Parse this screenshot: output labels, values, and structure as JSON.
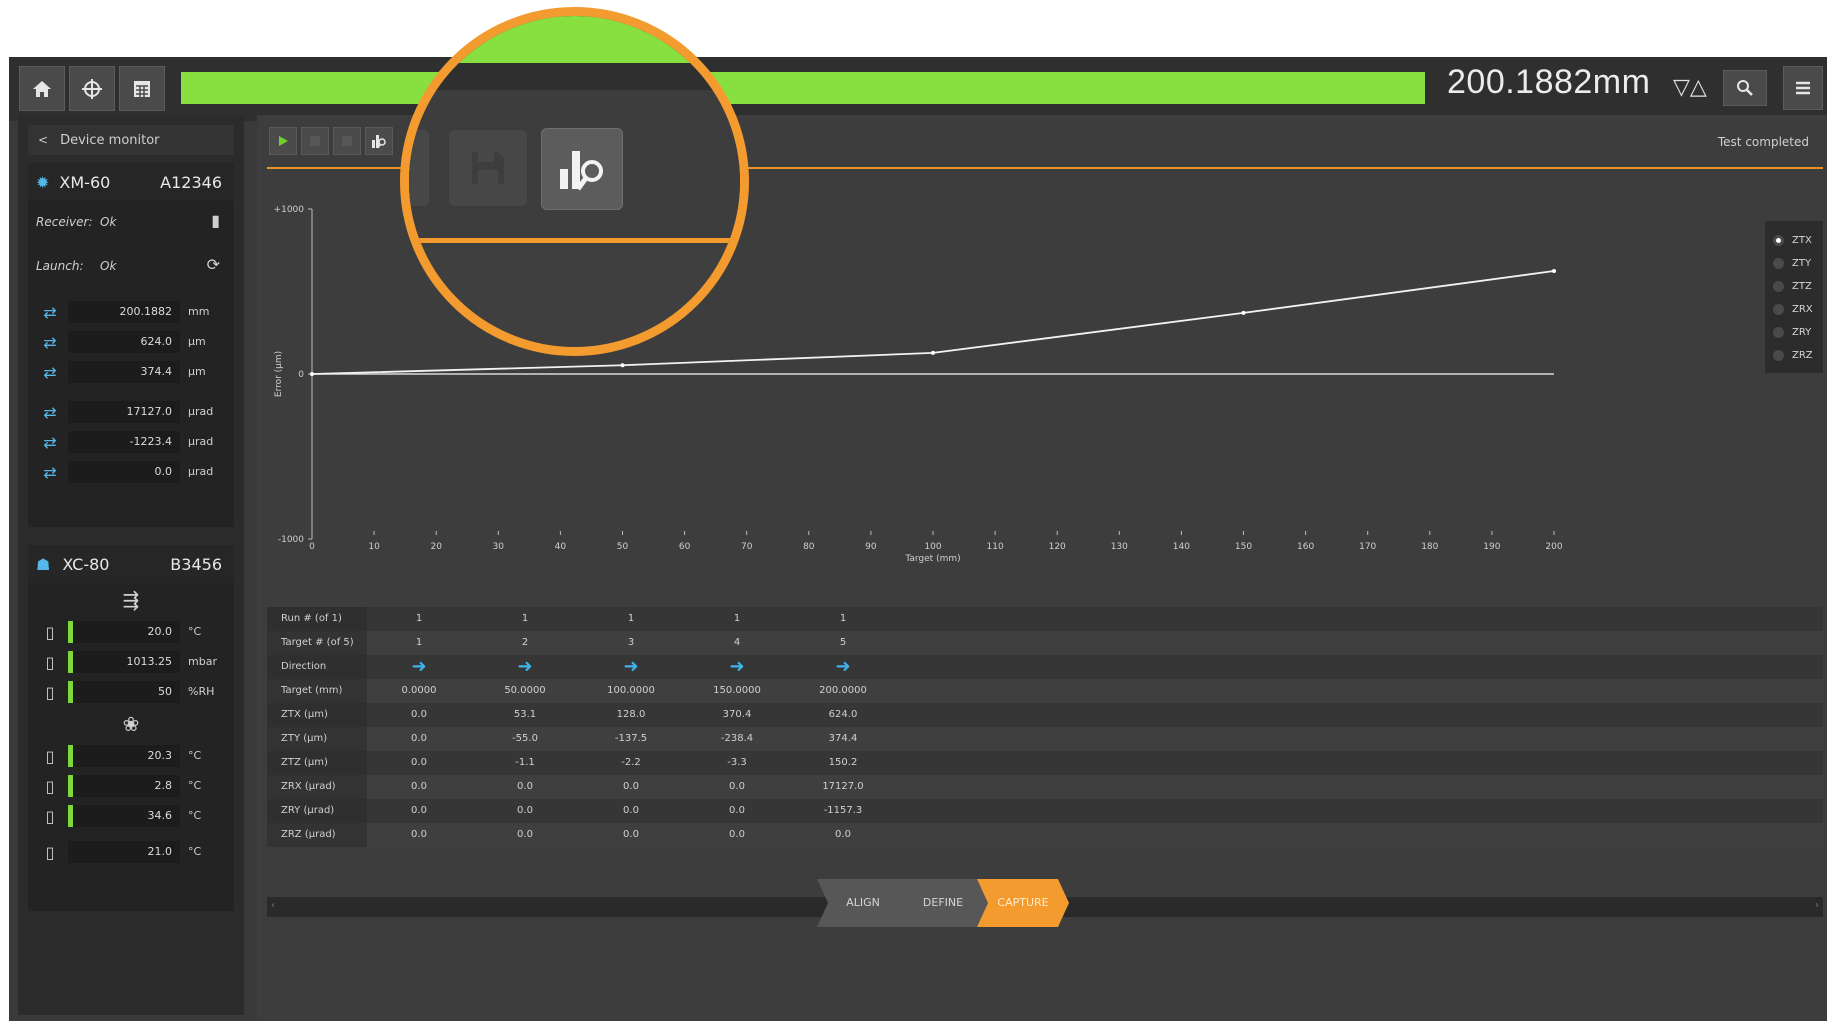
{
  "topbar": {
    "progress_fraction": 1.0,
    "progress_color": "#88e040",
    "readout": "200.1882mm",
    "direction_glyph": "▽△",
    "icons": [
      "home-icon",
      "target-icon",
      "calculator-icon",
      "search-icon",
      "menu-icon"
    ]
  },
  "device_monitor": {
    "title": "Device monitor",
    "xm": {
      "name": "XM-60",
      "serial": "A12346",
      "receiver_label": "Receiver:",
      "receiver_value": "Ok",
      "launch_label": "Launch:",
      "launch_value": "Ok",
      "values": [
        {
          "icon": "linear-icon",
          "value": "200.1882",
          "unit": "mm"
        },
        {
          "icon": "straightness-h-icon",
          "value": "624.0",
          "unit": "µm"
        },
        {
          "icon": "straightness-v-icon",
          "value": "374.4",
          "unit": "µm"
        },
        {
          "icon": "pitch-icon",
          "value": "17127.0",
          "unit": "µrad"
        },
        {
          "icon": "yaw-icon",
          "value": "-1223.4",
          "unit": "µrad"
        },
        {
          "icon": "roll-icon",
          "value": "0.0",
          "unit": "µrad"
        }
      ]
    },
    "xc": {
      "name": "XC-80",
      "serial": "B3456",
      "air": [
        {
          "icon": "thermometer-icon",
          "value": "20.0",
          "unit": "°C"
        },
        {
          "icon": "pressure-icon",
          "value": "1013.25",
          "unit": "mbar"
        },
        {
          "icon": "humidity-icon",
          "value": "50",
          "unit": "%RH"
        }
      ],
      "material": [
        {
          "icon": "material-sensor-icon",
          "value": "20.3",
          "unit": "°C"
        },
        {
          "icon": "material-sensor-icon",
          "value": "2.8",
          "unit": "°C"
        },
        {
          "icon": "material-sensor-icon",
          "value": "34.6",
          "unit": "°C"
        },
        {
          "icon": "material-sensor-icon",
          "value": "21.0",
          "unit": "°C"
        }
      ]
    }
  },
  "toolbar": {
    "status": "Test completed",
    "buttons": [
      "play-icon",
      "stop-icon",
      "save-icon",
      "analysis-icon"
    ]
  },
  "chart_data": {
    "type": "line",
    "xlabel": "Target (mm)",
    "ylabel": "Error (µm)",
    "xlim": [
      0,
      200
    ],
    "ylim": [
      -1000,
      1000
    ],
    "xticks": [
      0,
      10,
      20,
      30,
      40,
      50,
      60,
      70,
      80,
      90,
      100,
      110,
      120,
      130,
      140,
      150,
      160,
      170,
      180,
      190,
      200
    ],
    "yticks": [
      "1000",
      "0",
      "-1000"
    ],
    "series": [
      {
        "name": "ZTX",
        "x": [
          0,
          50,
          100,
          150,
          200
        ],
        "y": [
          0.0,
          53.1,
          128.0,
          370.4,
          624.0
        ]
      }
    ],
    "legend": [
      "ZTX",
      "ZTY",
      "ZTZ",
      "ZRX",
      "ZRY",
      "ZRZ"
    ],
    "legend_selected": "ZTX",
    "legend_position": "right"
  },
  "table": {
    "rows": [
      {
        "label": "Run # (of 1)",
        "cells": [
          "1",
          "1",
          "1",
          "1",
          "1"
        ]
      },
      {
        "label": "Target # (of 5)",
        "cells": [
          "1",
          "2",
          "3",
          "4",
          "5"
        ]
      },
      {
        "label": "Direction",
        "cells": [
          "➜",
          "➜",
          "➜",
          "➜",
          "➜"
        ],
        "arrow": true
      },
      {
        "label": "Target (mm)",
        "cells": [
          "0.0000",
          "50.0000",
          "100.0000",
          "150.0000",
          "200.0000"
        ]
      },
      {
        "label": "ZTX (µm)",
        "cells": [
          "0.0",
          "53.1",
          "128.0",
          "370.4",
          "624.0"
        ]
      },
      {
        "label": "ZTY (µm)",
        "cells": [
          "0.0",
          "-55.0",
          "-137.5",
          "-238.4",
          "374.4"
        ]
      },
      {
        "label": "ZTZ (µm)",
        "cells": [
          "0.0",
          "-1.1",
          "-2.2",
          "-3.3",
          "150.2"
        ]
      },
      {
        "label": "ZRX (µrad)",
        "cells": [
          "0.0",
          "0.0",
          "0.0",
          "0.0",
          "17127.0"
        ]
      },
      {
        "label": "ZRY (µrad)",
        "cells": [
          "0.0",
          "0.0",
          "0.0",
          "0.0",
          "-1157.3"
        ]
      },
      {
        "label": "ZRZ (µrad)",
        "cells": [
          "0.0",
          "0.0",
          "0.0",
          "0.0",
          "0.0"
        ]
      }
    ]
  },
  "steps": [
    {
      "label": "ALIGN",
      "active": false
    },
    {
      "label": "DEFINE",
      "active": false
    },
    {
      "label": "CAPTURE",
      "active": true
    }
  ],
  "colors": {
    "accent": "#f39b2f",
    "progress": "#88e040",
    "arrow": "#3fb4ec",
    "level_bar": "#7dd83c"
  }
}
